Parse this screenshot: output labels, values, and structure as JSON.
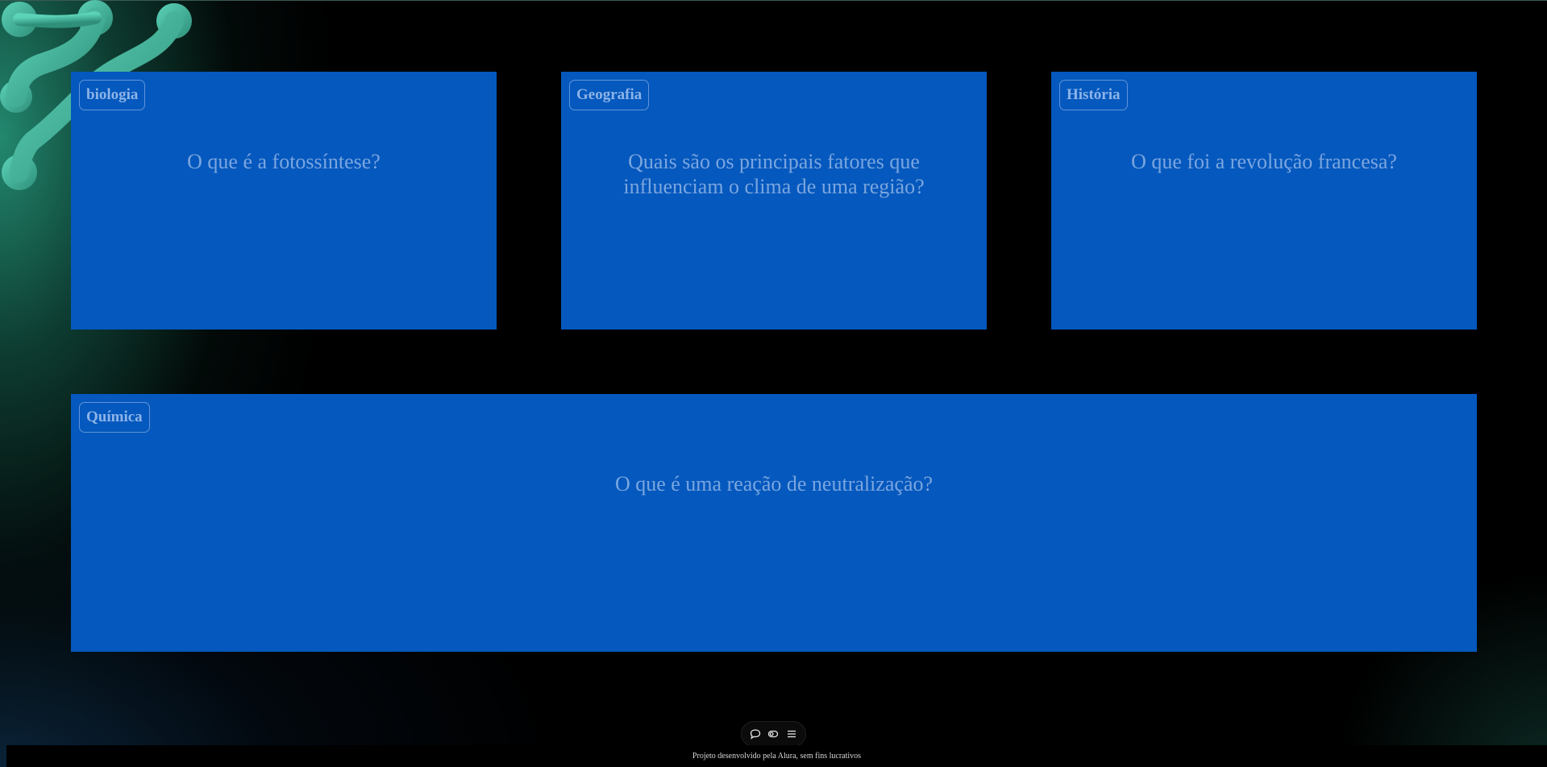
{
  "cards": [
    {
      "subject": "biologia",
      "question": "O que é a fotossíntese?"
    },
    {
      "subject": "Geografia",
      "question": "Quais são os principais fatores que influenciam o clima de uma região?"
    },
    {
      "subject": "História",
      "question": "O que foi a revolução francesa?"
    },
    {
      "subject": "Química",
      "question": "O que é uma reação de neutralização?"
    }
  ],
  "toolbar": {
    "icons": [
      "chat-bubble-icon",
      "toggle-icon",
      "menu-icon"
    ]
  },
  "footer": {
    "text": "Projeto desenvolvido pela Alura, sem fins lucrativos"
  },
  "colors": {
    "card_background": "#0558bd",
    "tag_text": "#8db4e8",
    "question_text": "#7aa6e0",
    "page_background": "#000000",
    "decoration": "#4cbfa6"
  }
}
